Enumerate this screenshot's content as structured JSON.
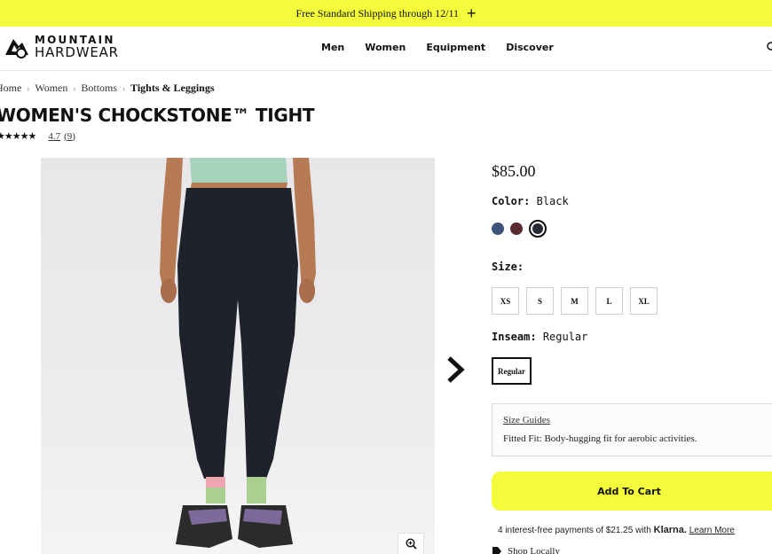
{
  "promo": {
    "text": "Free Standard Shipping through 12/11",
    "expand_icon": "plus-icon"
  },
  "header": {
    "logo_line1": "MOUNTAIN",
    "logo_line2": "HARDWEAR",
    "nav": [
      "Men",
      "Women",
      "Equipment",
      "Discover"
    ],
    "search_icon": "search-icon"
  },
  "breadcrumb": {
    "items": [
      "Home",
      "Women",
      "Bottoms"
    ],
    "current": "Tights & Leggings"
  },
  "product": {
    "title": "WOMEN'S CHOCKSTONE™ TIGHT",
    "stars": "★★★★★",
    "rating": "4.7",
    "review_count": "(9)",
    "price": "$85.00",
    "color_label": "Color:",
    "color_value": "Black",
    "swatches": [
      {
        "name": "blue",
        "color": "#3d5379"
      },
      {
        "name": "maroon",
        "color": "#5a2a31"
      },
      {
        "name": "black",
        "color": "#262a33",
        "selected": true
      }
    ],
    "size_label": "Size:",
    "sizes": [
      "XS",
      "S",
      "M",
      "L",
      "XL"
    ],
    "inseam_label": "Inseam:",
    "inseam_value": "Regular",
    "inseam_option": "Regular",
    "size_guides": "Size Guides",
    "fit_note": "Fitted Fit: Body-hugging fit for aerobic activities.",
    "add_to_cart": "Add To Cart",
    "klarna_text": "4 interest-free payments of $21.25 with",
    "klarna_brand": "Klarna.",
    "klarna_link": "Learn More",
    "shop_locally": "Shop Locally"
  },
  "colors": {
    "accent": "#f4fb3a",
    "text": "#111111"
  }
}
